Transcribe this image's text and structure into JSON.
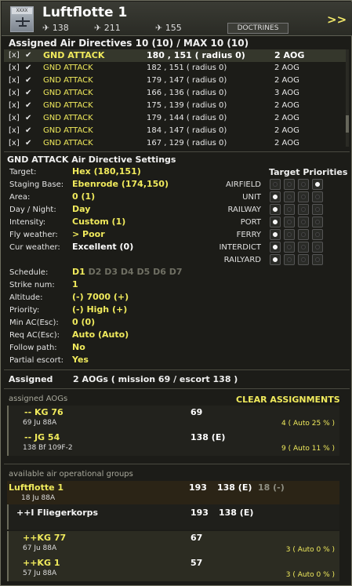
{
  "header": {
    "emblem_tag": "XXXX",
    "title": "Luftflotte 1",
    "counts": [
      "138",
      "211",
      "155"
    ],
    "doctrines_label": "DOCTRINES",
    "more_label": ">>"
  },
  "directives": {
    "title": "Assigned Air Directives 10 (10) / MAX 10 (10)",
    "rows": [
      {
        "x": "[x]",
        "type": "GND ATTACK",
        "coords": "180 , 151 ( radius 0)",
        "aog": "2 AOG"
      },
      {
        "x": "[x]",
        "type": "GND ATTACK",
        "coords": "182 , 151 ( radius 0)",
        "aog": "2 AOG"
      },
      {
        "x": "[x]",
        "type": "GND ATTACK",
        "coords": "179 , 147 ( radius 0)",
        "aog": "2 AOG"
      },
      {
        "x": "[x]",
        "type": "GND ATTACK",
        "coords": "166 , 136 ( radius 0)",
        "aog": "3 AOG"
      },
      {
        "x": "[x]",
        "type": "GND ATTACK",
        "coords": "175 , 139 ( radius 0)",
        "aog": "2 AOG"
      },
      {
        "x": "[x]",
        "type": "GND ATTACK",
        "coords": "179 , 144 ( radius 0)",
        "aog": "2 AOG"
      },
      {
        "x": "[x]",
        "type": "GND ATTACK",
        "coords": "184 , 147 ( radius 0)",
        "aog": "2 AOG"
      },
      {
        "x": "[x]",
        "type": "GND ATTACK",
        "coords": "167 , 129 ( radius 0)",
        "aog": "2 AOG"
      }
    ]
  },
  "settings": {
    "title": "GND ATTACK Air Directive Settings",
    "target_label": "Target:",
    "target": "Hex (180,151)",
    "staging_label": "Staging Base:",
    "staging": "Ebenrode (174,150)",
    "area_label": "Area:",
    "area": "0 (1)",
    "daynight_label": "Day / Night:",
    "daynight": "Day",
    "intensity_label": "Intensity:",
    "intensity": "Custom (1)",
    "flyweather_label": "Fly weather:",
    "flyweather": "> Poor",
    "curweather_label": "Cur weather:",
    "curweather": "Excellent (0)",
    "schedule_label": "Schedule:",
    "schedule_active": "D1",
    "schedule_rest": "D2 D3 D4 D5 D6 D7",
    "strike_label": "Strike num:",
    "strike": "1",
    "altitude_label": "Altitude:",
    "altitude": "(-) 7000 (+)",
    "priority_label": "Priority:",
    "priority": "(-) High (+)",
    "minac_label": "Min AC(Esc):",
    "minac": "0 (0)",
    "reqac_label": "Req AC(Esc):",
    "reqac": "Auto (Auto)",
    "follow_label": "Follow path:",
    "follow": "No",
    "partial_label": "Partial escort:",
    "partial": "Yes"
  },
  "priorities": {
    "title": "Target Priorities",
    "rows": [
      {
        "label": "AIRFIELD",
        "level": 4
      },
      {
        "label": "UNIT",
        "level": 1
      },
      {
        "label": "RAILWAY",
        "level": 1
      },
      {
        "label": "PORT",
        "level": 1
      },
      {
        "label": "FERRY",
        "level": 1
      },
      {
        "label": "INTERDICT",
        "level": 1
      },
      {
        "label": "RAILYARD",
        "level": 1
      }
    ]
  },
  "assigned": {
    "label": "Assigned",
    "summary": "2 AOGs  ( mission 69 / escort 138 )",
    "aogs_title": "assigned AOGs",
    "clear_label": "CLEAR ASSIGNMENTS",
    "groups": [
      {
        "name": "--  KG 76",
        "sub": "69 Ju 88A",
        "num": "69",
        "auto": "4  ( Auto 25 % )"
      },
      {
        "name": "--  JG 54",
        "sub": "138 Bf 109F-2",
        "num": "138 (E)",
        "auto": "9  ( Auto 11 % )"
      }
    ]
  },
  "available": {
    "title": "available air operational groups",
    "hq": {
      "name": "Luftflotte 1",
      "sub": "18 Ju 88A",
      "n1": "193",
      "n2": "138 (E)",
      "n3": "18 (-)"
    },
    "corps": {
      "name": "++I Fliegerkorps",
      "n1": "193",
      "n2": "138 (E)"
    },
    "groups": [
      {
        "name": "++KG 77",
        "sub": "67 Ju 88A",
        "num": "67",
        "auto": "3  ( Auto 0 % )"
      },
      {
        "name": "++KG 1",
        "sub": "57 Ju 88A",
        "num": "57",
        "auto": "3  ( Auto 0 % )"
      }
    ]
  },
  "colors": {
    "accent": "#f0ea5c",
    "background": "#1c1c18",
    "selected_row": "#35372c"
  }
}
